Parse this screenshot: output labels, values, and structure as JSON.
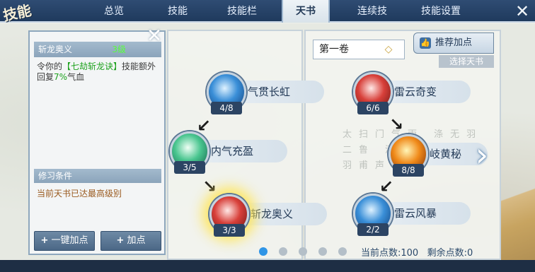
{
  "logo_text": "技能",
  "nav": {
    "tabs": [
      "总览",
      "技能",
      "技能栏",
      "天书",
      "连续技",
      "技能设置"
    ],
    "active_index": 3
  },
  "left_panel": {
    "skill_name": "斩龙奥义",
    "skill_level": "3级",
    "desc_part1": "令你的",
    "desc_highlight": "【七劫斩龙诀】",
    "desc_part2": "技能额外回复",
    "desc_percent": "7%",
    "desc_part3": "气血",
    "section_title": "修习条件",
    "condition_text": "当前天书已达最高级别",
    "btn_one_click": "一键加点",
    "btn_add": "加点"
  },
  "book": {
    "volume_title": "第一卷",
    "recommend_label": "推荐加点",
    "choose_book_label": "选择天书",
    "background_chars": "太扫门气雨 涤无羽二鲁 清何四羽清 羽甫声乞乏",
    "current_points_label": "当前点数:",
    "current_points_value": "100",
    "remaining_points_label": "剩余点数:",
    "remaining_points_value": "0",
    "page_count": 5,
    "page_active": 0
  },
  "skills": {
    "left_column": [
      {
        "name": "气贯长虹",
        "count": "4/8",
        "orb": "blue"
      },
      {
        "name": "内气充盈",
        "count": "3/5",
        "orb": "green"
      },
      {
        "name": "斩龙奥义",
        "count": "3/3",
        "orb": "red",
        "selected": true
      }
    ],
    "right_column": [
      {
        "name": "雷云奇变",
        "count": "6/6",
        "orb": "red"
      },
      {
        "name": "岐黄秘",
        "count": "8/8",
        "orb": "fire"
      },
      {
        "name": "雷云风暴",
        "count": "2/2",
        "orb": "blue"
      }
    ]
  },
  "icons": {
    "close": "close-icon",
    "thumbs_up": "thumbs-up-icon",
    "next_page": "chevron-right-icon",
    "down_arrow": "arrow-down-icon"
  }
}
